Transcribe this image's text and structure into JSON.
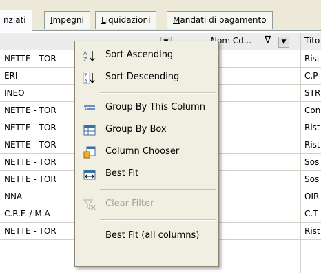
{
  "tabs": [
    {
      "label": "nziati",
      "u": "",
      "rest": ""
    },
    {
      "label": "",
      "u": "I",
      "rest": "mpegni"
    },
    {
      "label": "",
      "u": "L",
      "rest": "iquidazioni"
    },
    {
      "label": "",
      "u": "M",
      "rest": "andati di pagamento"
    }
  ],
  "header": {
    "col2_label": "Nom Cd...",
    "col3_label": "Tito"
  },
  "rows": [
    {
      "c1": "NETTE - TOR",
      "c3": "Rist"
    },
    {
      "c1": "ERI",
      "c3": "C.P"
    },
    {
      "c1": "INEO",
      "c3": "STR"
    },
    {
      "c1": "NETTE - TOR",
      "c3": "Con"
    },
    {
      "c1": "NETTE - TOR",
      "c3": "Rist"
    },
    {
      "c1": "NETTE - TOR",
      "c3": "Rist"
    },
    {
      "c1": "NETTE - TOR",
      "c3": "Sos"
    },
    {
      "c1": "NETTE - TOR",
      "c3": "Sos"
    },
    {
      "c1": "NNA",
      "c3": "OIR"
    },
    {
      "c1": " C.R.F. / M.A",
      "c3": "C.T"
    },
    {
      "c1": "NETTE - TOR",
      "c3": "Rist"
    }
  ],
  "menu": {
    "sort_asc": "Sort Ascending",
    "sort_desc": "Sort Descending",
    "group_col": "Group By This Column",
    "group_box": "Group By Box",
    "col_chooser": "Column Chooser",
    "best_fit": "Best Fit",
    "clear_filter": "Clear Filter",
    "best_fit_all": "Best Fit (all columns)"
  },
  "icons": {
    "sort_asc": "sort-ascending-icon",
    "sort_desc": "sort-descending-icon",
    "group_col": "group-by-column-icon",
    "group_box": "group-by-box-icon",
    "col_chooser": "column-chooser-icon",
    "best_fit": "best-fit-icon",
    "clear_filter": "clear-filter-icon"
  },
  "colors": {
    "accent": "#3a6ea5",
    "tab_border": "#919b9c"
  }
}
